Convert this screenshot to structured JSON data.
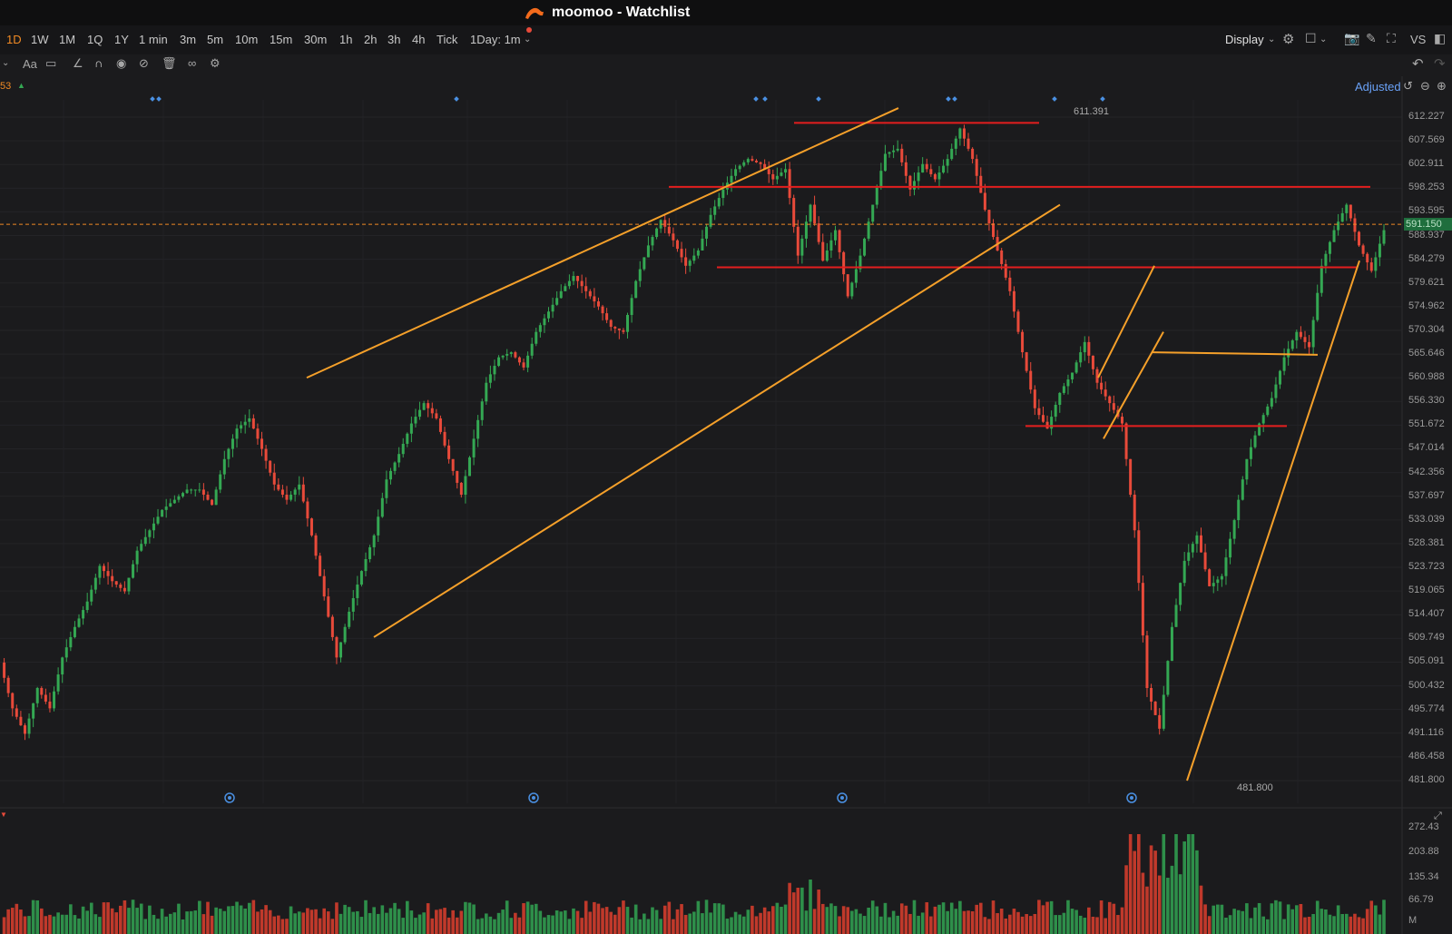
{
  "window": {
    "title": "moomoo - Watchlist"
  },
  "periods": [
    "1D",
    "1W",
    "1M",
    "1Q",
    "1Y",
    "1 min",
    "3m",
    "5m",
    "10m",
    "15m",
    "30m",
    "1h",
    "2h",
    "3h",
    "4h",
    "Tick",
    "1Day: 1m"
  ],
  "active_period": "1D",
  "toolbar": {
    "display_label": "Display",
    "vs_label": "VS",
    "adjusted_label": "Adjusted"
  },
  "indicator": {
    "value_fragment": "53",
    "arrow": "▲"
  },
  "price_axis": {
    "ticks": [
      "612.227",
      "607.569",
      "602.911",
      "598.253",
      "593.595",
      "588.937",
      "584.279",
      "579.621",
      "574.962",
      "570.304",
      "565.646",
      "560.988",
      "556.330",
      "551.672",
      "547.014",
      "542.356",
      "537.697",
      "533.039",
      "528.381",
      "523.723",
      "519.065",
      "514.407",
      "509.749",
      "505.091",
      "500.432",
      "495.774",
      "491.116",
      "486.458",
      "481.800"
    ],
    "current_price": "591.150",
    "high_label": "611.391",
    "low_label": "481.800"
  },
  "volume_axis": {
    "ticks": [
      "272.43",
      "203.88",
      "135.34",
      "66.79",
      "M"
    ]
  },
  "colors": {
    "up": "#34a853",
    "down": "#e84a3a",
    "trendline": "#f5a02a",
    "level": "#e31e1e",
    "accent": "#f08a24"
  },
  "chart_data": {
    "type": "candlestick",
    "ylim": [
      481.8,
      612.227
    ],
    "high": 611.391,
    "low": 481.8,
    "last": 591.15,
    "price_path": [
      [
        0,
        505
      ],
      [
        3,
        496
      ],
      [
        6,
        491
      ],
      [
        9,
        500
      ],
      [
        12,
        496
      ],
      [
        15,
        506
      ],
      [
        18,
        512
      ],
      [
        21,
        517
      ],
      [
        24,
        524
      ],
      [
        27,
        521
      ],
      [
        30,
        519
      ],
      [
        33,
        527
      ],
      [
        36,
        531
      ],
      [
        39,
        535
      ],
      [
        42,
        537
      ],
      [
        45,
        539
      ],
      [
        48,
        539
      ],
      [
        51,
        536
      ],
      [
        54,
        545
      ],
      [
        57,
        551
      ],
      [
        60,
        553
      ],
      [
        63,
        547
      ],
      [
        66,
        540
      ],
      [
        69,
        537
      ],
      [
        72,
        540
      ],
      [
        75,
        530
      ],
      [
        78,
        518
      ],
      [
        81,
        506
      ],
      [
        84,
        515
      ],
      [
        87,
        523
      ],
      [
        90,
        530
      ],
      [
        93,
        541
      ],
      [
        96,
        546
      ],
      [
        99,
        552
      ],
      [
        102,
        556
      ],
      [
        105,
        553
      ],
      [
        108,
        545
      ],
      [
        111,
        538
      ],
      [
        114,
        549
      ],
      [
        117,
        560
      ],
      [
        120,
        565
      ],
      [
        123,
        566
      ],
      [
        126,
        563
      ],
      [
        129,
        570
      ],
      [
        132,
        574
      ],
      [
        135,
        578
      ],
      [
        138,
        581
      ],
      [
        141,
        578
      ],
      [
        144,
        575
      ],
      [
        147,
        571
      ],
      [
        150,
        570
      ],
      [
        153,
        580
      ],
      [
        156,
        587
      ],
      [
        159,
        592
      ],
      [
        162,
        588
      ],
      [
        165,
        583
      ],
      [
        168,
        586
      ],
      [
        171,
        593
      ],
      [
        174,
        598
      ],
      [
        177,
        602
      ],
      [
        180,
        604
      ],
      [
        183,
        603
      ],
      [
        186,
        600
      ],
      [
        189,
        602
      ],
      [
        192,
        585
      ],
      [
        195,
        595
      ],
      [
        198,
        584
      ],
      [
        201,
        590
      ],
      [
        204,
        577
      ],
      [
        207,
        585
      ],
      [
        210,
        595
      ],
      [
        213,
        605
      ],
      [
        216,
        606
      ],
      [
        219,
        598
      ],
      [
        222,
        603
      ],
      [
        225,
        600
      ],
      [
        228,
        604
      ],
      [
        231,
        610
      ],
      [
        234,
        604
      ],
      [
        237,
        594
      ],
      [
        240,
        586
      ],
      [
        243,
        578
      ],
      [
        246,
        566
      ],
      [
        249,
        555
      ],
      [
        252,
        551
      ],
      [
        255,
        558
      ],
      [
        258,
        562
      ],
      [
        261,
        568
      ],
      [
        264,
        560
      ],
      [
        267,
        556
      ],
      [
        270,
        552
      ],
      [
        273,
        531
      ],
      [
        276,
        500
      ],
      [
        279,
        492
      ],
      [
        282,
        512
      ],
      [
        285,
        525
      ],
      [
        288,
        530
      ],
      [
        291,
        520
      ],
      [
        294,
        522
      ],
      [
        297,
        533
      ],
      [
        300,
        545
      ],
      [
        303,
        552
      ],
      [
        306,
        557
      ],
      [
        309,
        565
      ],
      [
        312,
        570
      ],
      [
        315,
        567
      ],
      [
        318,
        583
      ],
      [
        321,
        590
      ],
      [
        324,
        595
      ],
      [
        327,
        587
      ],
      [
        330,
        582
      ],
      [
        333,
        590
      ]
    ],
    "volume_ticks": [
      "272.43",
      "203.88",
      "135.34",
      "66.79"
    ]
  }
}
